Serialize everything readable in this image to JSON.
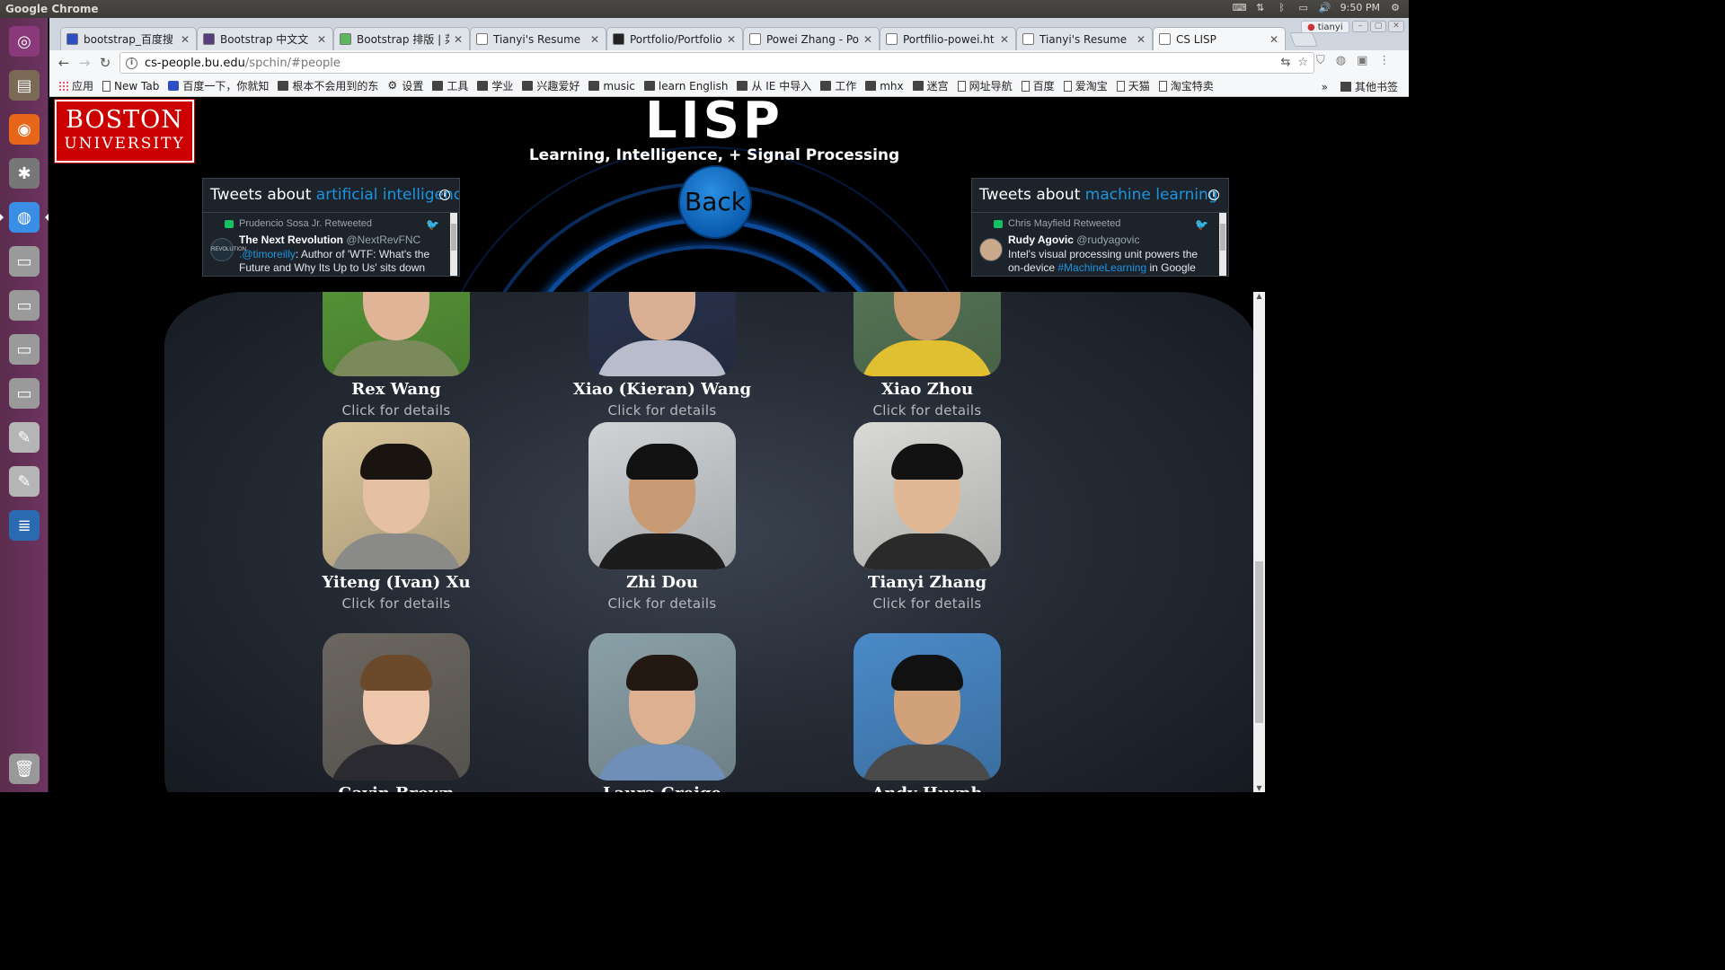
{
  "os_panel": {
    "app_title": "Google Chrome",
    "time": "9:50 PM"
  },
  "launcher": {
    "items": [
      {
        "name": "ubuntu-dash-icon",
        "color": "#8a3a7a"
      },
      {
        "name": "files-icon",
        "color": "#7a6a55"
      },
      {
        "name": "firefox-icon",
        "color": "#e8661a"
      },
      {
        "name": "system-settings-icon",
        "color": "#777777"
      },
      {
        "name": "chrome-icon",
        "color": "#3a8ee6"
      },
      {
        "name": "drive-icon",
        "color": "#9a9a9a"
      },
      {
        "name": "drive-icon",
        "color": "#9a9a9a"
      },
      {
        "name": "drive-icon",
        "color": "#9a9a9a"
      },
      {
        "name": "drive-icon",
        "color": "#9a9a9a"
      },
      {
        "name": "text-editor-icon",
        "color": "#b5b5b5"
      },
      {
        "name": "text-editor-icon",
        "color": "#b5b5b5"
      },
      {
        "name": "libreoffice-writer-icon",
        "color": "#2a6ab0"
      }
    ]
  },
  "browser": {
    "tabs": [
      {
        "title": "bootstrap_百度搜",
        "favicon_color": "#2d4ec4"
      },
      {
        "title": "Bootstrap 中文文",
        "favicon_color": "#563d7c"
      },
      {
        "title": "Bootstrap 排版 | 菜",
        "favicon_color": "#5cb85c"
      },
      {
        "title": "Tianyi's Resume",
        "favicon_color": "#ffffff"
      },
      {
        "title": "Portfolio/Portfolio",
        "favicon_color": "#222222"
      },
      {
        "title": "Powei Zhang - Por",
        "favicon_color": "#ffffff"
      },
      {
        "title": "Portfilio-powei.ht",
        "favicon_color": "#ffffff"
      },
      {
        "title": "Tianyi's Resume",
        "favicon_color": "#ffffff"
      },
      {
        "title": "CS LISP",
        "favicon_color": "#ffffff",
        "active": true
      }
    ],
    "profile_name": "tianyi",
    "url_host": "cs-people.bu.edu",
    "url_path": "/spchin/#people",
    "bookmarks": [
      {
        "label": "应用",
        "icon": "apps"
      },
      {
        "label": "New Tab",
        "icon": "page"
      },
      {
        "label": "百度一下，你就知",
        "icon": "baidu"
      },
      {
        "label": "根本不会用到的东",
        "icon": "folder"
      },
      {
        "label": "设置",
        "icon": "gear"
      },
      {
        "label": "工具",
        "icon": "folder"
      },
      {
        "label": "学业",
        "icon": "folder"
      },
      {
        "label": "兴趣爱好",
        "icon": "folder"
      },
      {
        "label": "music",
        "icon": "folder"
      },
      {
        "label": "learn English",
        "icon": "folder"
      },
      {
        "label": "从 IE 中导入",
        "icon": "folder"
      },
      {
        "label": "工作",
        "icon": "folder"
      },
      {
        "label": "mhx",
        "icon": "folder"
      },
      {
        "label": "迷宫",
        "icon": "folder"
      },
      {
        "label": "网址导航",
        "icon": "page"
      },
      {
        "label": "百度",
        "icon": "page"
      },
      {
        "label": "爱淘宝",
        "icon": "page"
      },
      {
        "label": "天猫",
        "icon": "page"
      },
      {
        "label": "淘宝特卖",
        "icon": "page"
      }
    ],
    "bookmarks_overflow": "»",
    "other_bookmarks": "其他书签"
  },
  "page": {
    "logo_line1": "BOSTON",
    "logo_line2": "UNIVERSITY",
    "title": "LISP",
    "subtitle": "Learning, Intelligence, + Signal Processing",
    "back_label": "Back",
    "tweets_left": {
      "prefix": "Tweets about ",
      "topic": "artificial intelligence",
      "retweeted_by": "Prudencio Sosa Jr. Retweeted",
      "avatar_text": "REVOLUTION",
      "author": "The Next Revolution",
      "handle": "@NextRevFNC",
      "text_link": ".@timoreilly",
      "text": ": Author of 'WTF: What's the Future and Why Its Up to Us' sits down with"
    },
    "tweets_right": {
      "prefix": "Tweets about ",
      "topic": "machine learning",
      "retweeted_by": "Chris Mayfield Retweeted",
      "author": "Rudy Agovic",
      "handle": "@rudyagovic",
      "text": "Intel's visual processing unit powers the on-device ",
      "text_link": "#MachineLearning",
      "text_end": " in Google Clips"
    },
    "people": [
      {
        "name": "Rex Wang",
        "link": "Click for details",
        "bg": "#5a9a3a",
        "skin": "#e0b497",
        "hair": "#1a1410",
        "shirt": "#7a8a5a"
      },
      {
        "name": "Xiao (Kieran) Wang",
        "link": "Click for details",
        "bg": "#2b3550",
        "skin": "#d9b094",
        "hair": "#151515",
        "shirt": "#b8bccb"
      },
      {
        "name": "Xiao Zhou",
        "link": "Click for details",
        "bg": "#5a7a5a",
        "skin": "#c9996f",
        "hair": "#151515",
        "shirt": "#e0c030"
      },
      {
        "name": "Yiteng (Ivan) Xu",
        "link": "Click for details",
        "bg": "#d8c49a",
        "skin": "#e6c0a2",
        "hair": "#1a1410",
        "shirt": "#8a8a88"
      },
      {
        "name": "Zhi Dou",
        "link": "Click for details",
        "bg": "#cfd3d6",
        "skin": "#c89a73",
        "hair": "#111111",
        "shirt": "#1c1c1c"
      },
      {
        "name": "Tianyi Zhang",
        "link": "Click for details",
        "bg": "#d9d9d6",
        "skin": "#e0b896",
        "hair": "#121212",
        "shirt": "#2a2a2a"
      },
      {
        "name": "Gavin Brown",
        "link": "Click for details",
        "bg": "#6b6660",
        "skin": "#efc7ad",
        "hair": "#6a4a2a",
        "shirt": "#2a2a30"
      },
      {
        "name": "Laura Greige",
        "link": "Click for details",
        "bg": "#8aa0a8",
        "skin": "#dcb090",
        "hair": "#241812",
        "shirt": "#6f8fb8"
      },
      {
        "name": "Andy Huynh",
        "link": "Click for details",
        "bg": "#4a8ac8",
        "skin": "#d1a27a",
        "hair": "#111111",
        "shirt": "#4a4a4a"
      }
    ]
  }
}
